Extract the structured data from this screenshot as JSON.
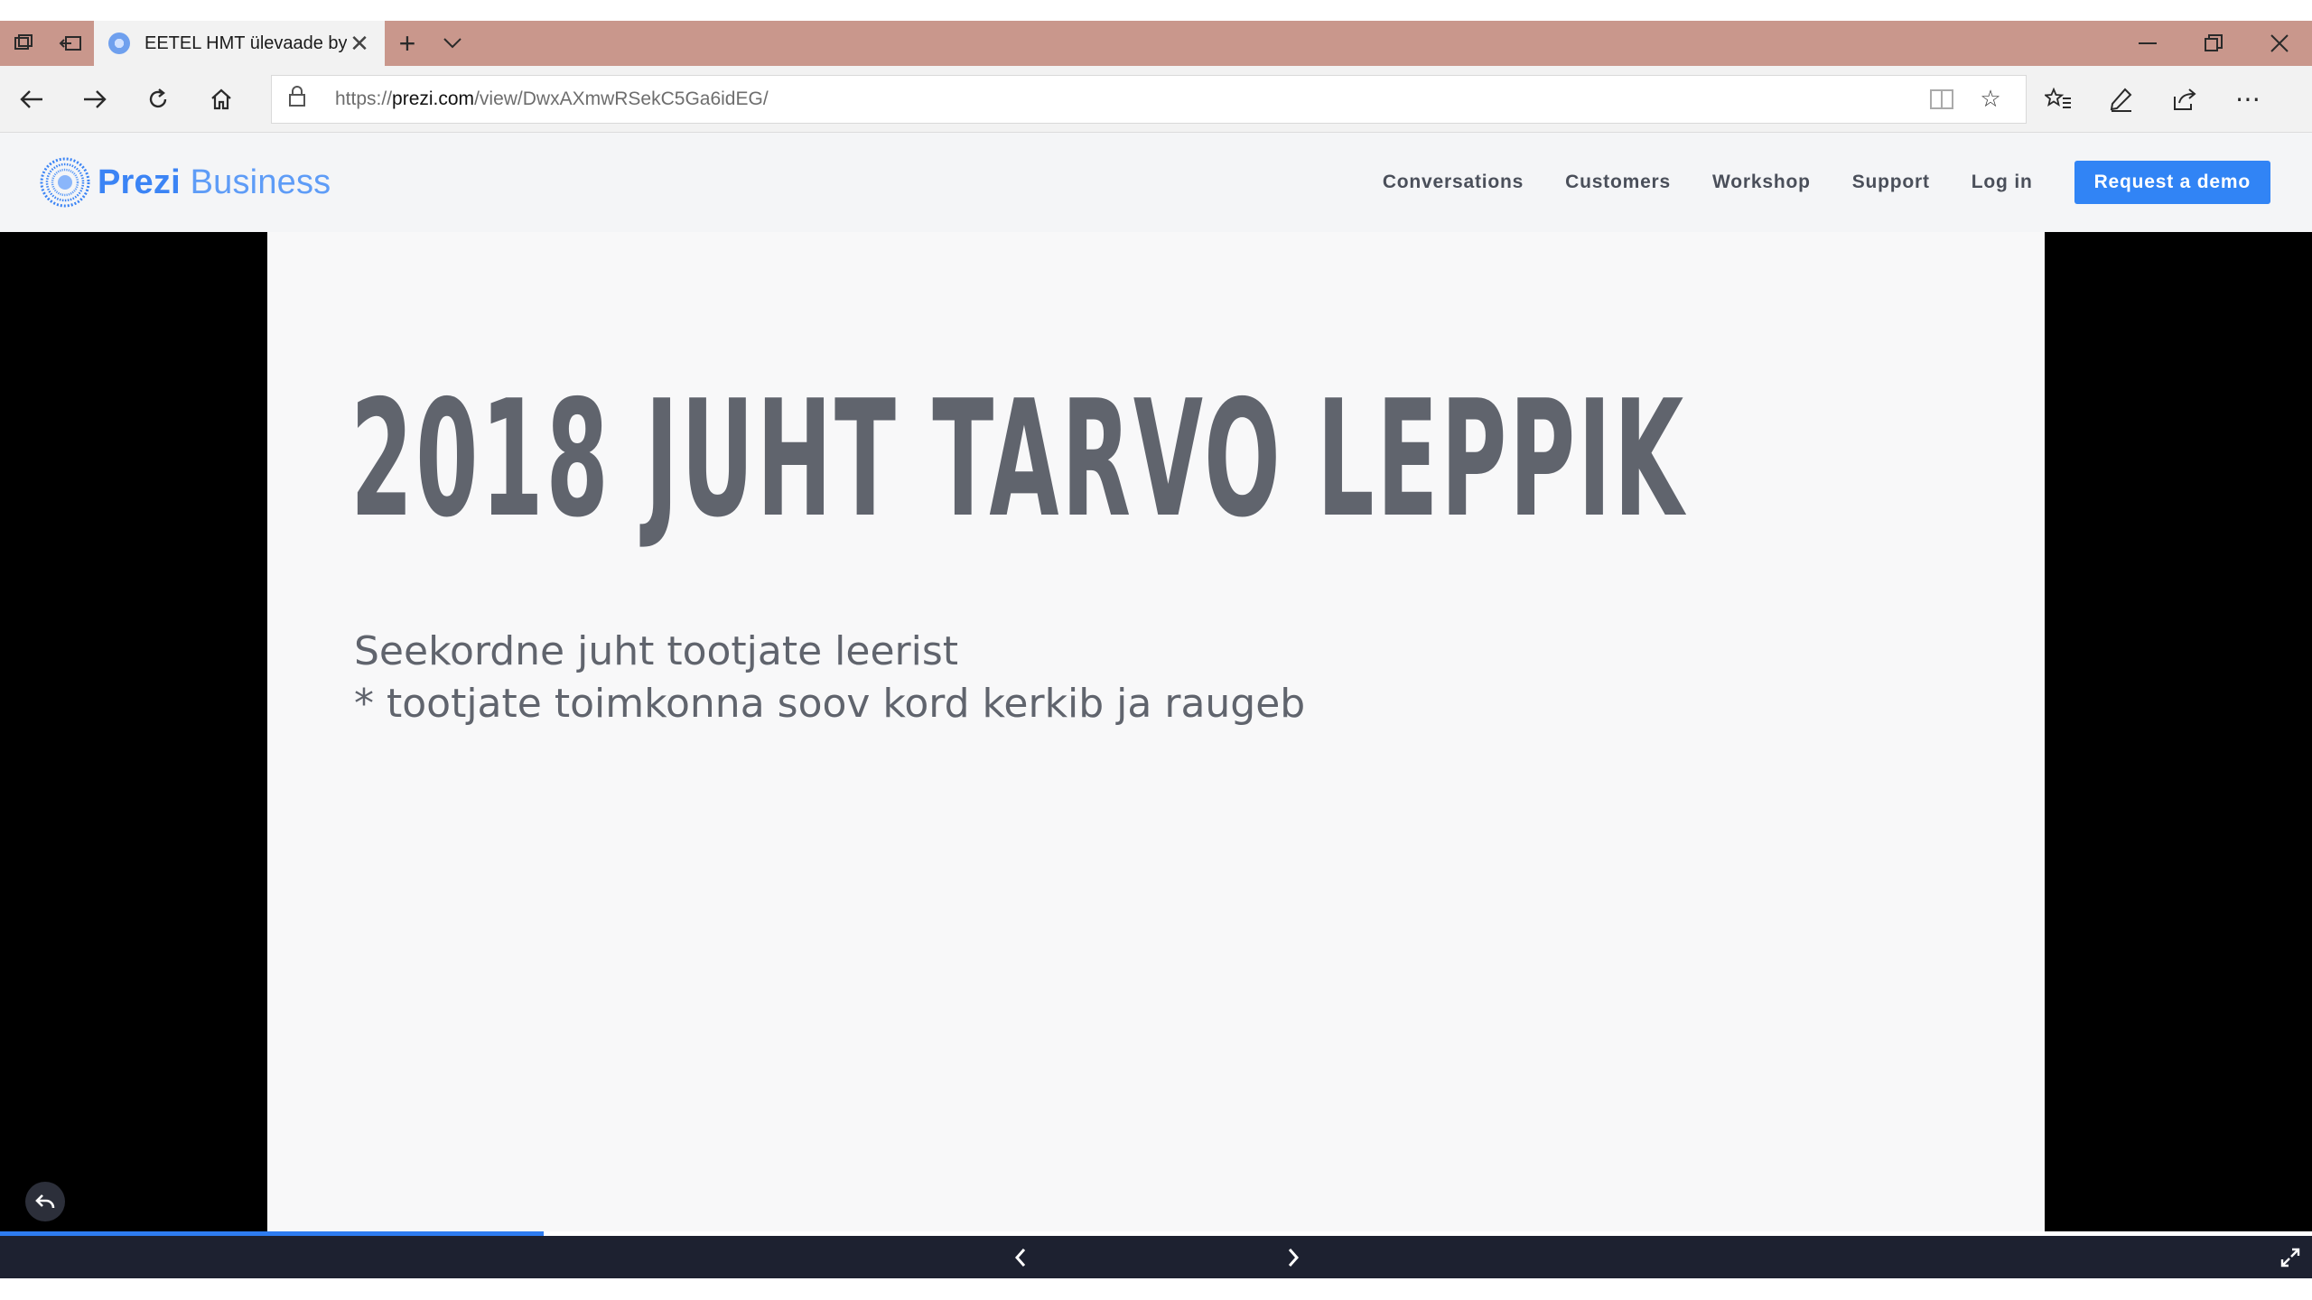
{
  "browser": {
    "tab_title": "EETEL HMT ülevaade by",
    "url_prefix": "https://",
    "url_domain": "prezi.com",
    "url_path": "/view/DwxAXmwRSekC5Ga6idEG/"
  },
  "site": {
    "logo_bold": "Prezi",
    "logo_light": "Business",
    "nav": [
      "Conversations",
      "Customers",
      "Workshop",
      "Support",
      "Log in"
    ],
    "cta": "Request a demo",
    "brand_color": "#3184f5"
  },
  "slide": {
    "title": "2018 JUHT TARVO LEPPIK",
    "line1": "Seekordne juht tootjate leerist",
    "line2": "* tootjate toimkonna soov kord kerkib ja raugeb"
  },
  "player": {
    "progress": 0.235
  }
}
